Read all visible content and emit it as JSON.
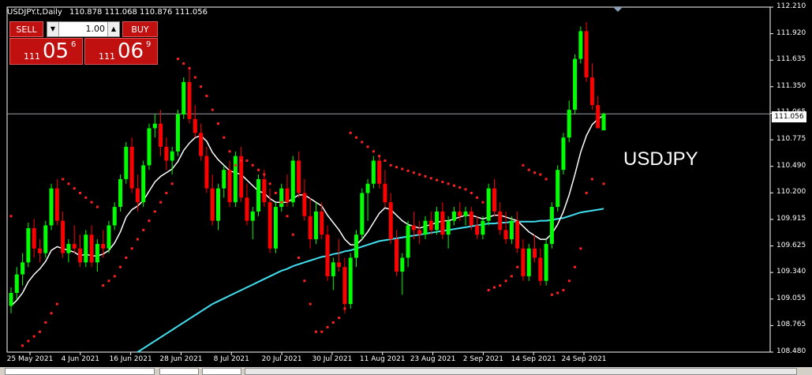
{
  "header": {
    "symbol": "USDJPY.t,Daily",
    "ohlc": "110.878 111.068 110.876 111.056"
  },
  "trade_panel": {
    "sell_label": "SELL",
    "buy_label": "BUY",
    "lot_value": "1.00",
    "sell_small": "111",
    "sell_big": "05",
    "sell_sup": "6",
    "buy_small": "111",
    "buy_big": "06",
    "buy_sup": "9"
  },
  "watermark": "USDJPY",
  "current_price_label": "111.056",
  "colors": {
    "bull": "#00ff00",
    "bear": "#ff0000",
    "ma_fast": "#ffffff",
    "ma_slow": "#40e0f0",
    "sar": "#ff2020",
    "background": "#000000"
  },
  "chart_data": {
    "type": "candlestick",
    "ylim": [
      108.48,
      112.21
    ],
    "y_ticks": [
      "112.210",
      "111.920",
      "111.635",
      "111.350",
      "111.065",
      "110.775",
      "110.490",
      "110.200",
      "109.915",
      "109.625",
      "109.340",
      "109.055",
      "108.765",
      "108.480"
    ],
    "x_ticks": [
      "25 May 2021",
      "4 Jun 2021",
      "16 Jun 2021",
      "28 Jun 2021",
      "8 Jul 2021",
      "20 Jul 2021",
      "30 Jul 2021",
      "11 Aug 2021",
      "23 Aug 2021",
      "2 Sep 2021",
      "14 Sep 2021",
      "24 Sep 2021"
    ],
    "current_price": 111.056,
    "candles": [
      [
        108.98,
        109.18,
        108.9,
        109.12
      ],
      [
        109.12,
        109.4,
        109.05,
        109.32
      ],
      [
        109.32,
        109.55,
        109.2,
        109.45
      ],
      [
        109.45,
        109.88,
        109.4,
        109.82
      ],
      [
        109.82,
        109.92,
        109.5,
        109.6
      ],
      [
        109.6,
        109.7,
        109.45,
        109.55
      ],
      [
        109.55,
        109.9,
        109.5,
        109.85
      ],
      [
        109.85,
        110.3,
        109.8,
        110.25
      ],
      [
        110.25,
        110.35,
        109.85,
        109.9
      ],
      [
        109.9,
        110.0,
        109.5,
        109.55
      ],
      [
        109.55,
        109.7,
        109.45,
        109.65
      ],
      [
        109.65,
        109.85,
        109.55,
        109.6
      ],
      [
        109.6,
        109.75,
        109.4,
        109.45
      ],
      [
        109.45,
        109.8,
        109.4,
        109.75
      ],
      [
        109.75,
        109.85,
        109.4,
        109.45
      ],
      [
        109.45,
        109.7,
        109.35,
        109.65
      ],
      [
        109.65,
        109.8,
        109.5,
        109.6
      ],
      [
        109.6,
        109.9,
        109.55,
        109.85
      ],
      [
        109.85,
        110.1,
        109.8,
        110.05
      ],
      [
        110.05,
        110.4,
        110.0,
        110.35
      ],
      [
        110.35,
        110.75,
        110.3,
        110.7
      ],
      [
        110.7,
        110.8,
        110.2,
        110.25
      ],
      [
        110.25,
        110.4,
        110.0,
        110.1
      ],
      [
        110.1,
        110.55,
        110.05,
        110.5
      ],
      [
        110.5,
        110.95,
        110.45,
        110.9
      ],
      [
        110.9,
        111.05,
        110.8,
        110.95
      ],
      [
        110.95,
        111.1,
        110.6,
        110.7
      ],
      [
        110.7,
        110.8,
        110.45,
        110.55
      ],
      [
        110.55,
        110.7,
        110.4,
        110.65
      ],
      [
        110.65,
        111.1,
        110.6,
        111.05
      ],
      [
        111.05,
        111.45,
        111.0,
        111.4
      ],
      [
        111.4,
        111.55,
        110.95,
        111.0
      ],
      [
        111.0,
        111.15,
        110.8,
        110.85
      ],
      [
        110.85,
        110.95,
        110.55,
        110.6
      ],
      [
        110.6,
        110.7,
        110.2,
        110.25
      ],
      [
        110.25,
        110.4,
        109.85,
        109.9
      ],
      [
        109.9,
        110.3,
        109.8,
        110.25
      ],
      [
        110.25,
        110.5,
        110.15,
        110.45
      ],
      [
        110.45,
        110.55,
        110.05,
        110.1
      ],
      [
        110.1,
        110.65,
        110.05,
        110.6
      ],
      [
        110.6,
        110.7,
        110.1,
        110.15
      ],
      [
        110.15,
        110.3,
        109.85,
        109.9
      ],
      [
        109.9,
        110.05,
        109.7,
        110.0
      ],
      [
        110.0,
        110.4,
        109.95,
        110.35
      ],
      [
        110.35,
        110.45,
        110.05,
        110.1
      ],
      [
        110.1,
        110.25,
        109.55,
        109.6
      ],
      [
        109.6,
        110.1,
        109.55,
        110.05
      ],
      [
        110.05,
        110.3,
        110.0,
        110.25
      ],
      [
        110.25,
        110.4,
        110.05,
        110.1
      ],
      [
        110.1,
        110.6,
        110.05,
        110.55
      ],
      [
        110.55,
        110.65,
        110.15,
        110.2
      ],
      [
        110.2,
        110.35,
        109.9,
        109.95
      ],
      [
        109.95,
        110.15,
        109.6,
        109.7
      ],
      [
        109.7,
        110.1,
        109.65,
        110.0
      ],
      [
        110.0,
        110.1,
        109.7,
        109.75
      ],
      [
        109.75,
        109.85,
        109.25,
        109.3
      ],
      [
        109.3,
        109.5,
        109.15,
        109.45
      ],
      [
        109.45,
        109.7,
        109.35,
        109.4
      ],
      [
        109.4,
        109.5,
        108.9,
        109.0
      ],
      [
        109.0,
        109.55,
        108.95,
        109.5
      ],
      [
        109.5,
        109.8,
        109.4,
        109.75
      ],
      [
        109.75,
        110.25,
        109.7,
        110.2
      ],
      [
        110.2,
        110.35,
        109.9,
        110.3
      ],
      [
        110.3,
        110.6,
        110.25,
        110.55
      ],
      [
        110.55,
        110.6,
        110.25,
        110.3
      ],
      [
        110.3,
        110.45,
        110.05,
        110.1
      ],
      [
        110.1,
        110.2,
        109.65,
        109.7
      ],
      [
        109.7,
        109.8,
        109.3,
        109.35
      ],
      [
        109.35,
        109.55,
        109.1,
        109.5
      ],
      [
        109.5,
        109.9,
        109.4,
        109.85
      ],
      [
        109.85,
        110.0,
        109.7,
        109.8
      ],
      [
        109.8,
        109.9,
        109.65,
        109.75
      ],
      [
        109.75,
        109.95,
        109.7,
        109.9
      ],
      [
        109.9,
        110.0,
        109.75,
        109.8
      ],
      [
        109.8,
        110.05,
        109.75,
        110.0
      ],
      [
        110.0,
        110.1,
        109.7,
        109.75
      ],
      [
        109.75,
        109.95,
        109.6,
        109.9
      ],
      [
        109.9,
        110.05,
        109.85,
        110.0
      ],
      [
        110.0,
        110.1,
        109.9,
        109.95
      ],
      [
        109.95,
        110.05,
        109.85,
        110.0
      ],
      [
        110.0,
        110.05,
        109.8,
        109.85
      ],
      [
        109.85,
        109.95,
        109.7,
        109.75
      ],
      [
        109.75,
        109.95,
        109.7,
        109.9
      ],
      [
        109.9,
        110.3,
        109.85,
        110.25
      ],
      [
        110.25,
        110.35,
        109.95,
        110.0
      ],
      [
        110.0,
        110.1,
        109.75,
        109.8
      ],
      [
        109.8,
        110.0,
        109.65,
        109.7
      ],
      [
        109.7,
        109.95,
        109.65,
        109.9
      ],
      [
        109.9,
        110.0,
        109.55,
        109.6
      ],
      [
        109.6,
        109.7,
        109.25,
        109.3
      ],
      [
        109.3,
        109.65,
        109.25,
        109.6
      ],
      [
        109.6,
        109.75,
        109.45,
        109.5
      ],
      [
        109.5,
        109.6,
        109.2,
        109.25
      ],
      [
        109.25,
        109.7,
        109.2,
        109.65
      ],
      [
        109.65,
        110.1,
        109.6,
        110.05
      ],
      [
        110.05,
        110.5,
        110.0,
        110.45
      ],
      [
        110.45,
        110.85,
        110.4,
        110.8
      ],
      [
        110.8,
        111.2,
        110.75,
        111.1
      ],
      [
        111.1,
        111.7,
        111.05,
        111.65
      ],
      [
        111.65,
        112.0,
        111.6,
        111.95
      ],
      [
        111.95,
        112.05,
        111.4,
        111.45
      ],
      [
        111.45,
        111.6,
        111.1,
        111.15
      ],
      [
        111.15,
        111.25,
        110.9,
        110.9
      ],
      [
        110.878,
        111.068,
        110.876,
        111.056
      ]
    ],
    "ma_fast": [
      108.98,
      109.04,
      109.12,
      109.24,
      109.32,
      109.38,
      109.46,
      109.58,
      109.62,
      109.6,
      109.58,
      109.56,
      109.52,
      109.54,
      109.52,
      109.52,
      109.54,
      109.58,
      109.66,
      109.78,
      109.94,
      110.02,
      110.06,
      110.12,
      110.22,
      110.32,
      110.38,
      110.42,
      110.46,
      110.54,
      110.66,
      110.74,
      110.8,
      110.82,
      110.76,
      110.64,
      110.56,
      110.5,
      110.44,
      110.42,
      110.4,
      110.34,
      110.28,
      110.22,
      110.2,
      110.14,
      110.1,
      110.1,
      110.1,
      110.14,
      110.18,
      110.18,
      110.14,
      110.1,
      110.06,
      109.96,
      109.88,
      109.8,
      109.7,
      109.64,
      109.64,
      109.7,
      109.78,
      109.88,
      109.98,
      110.04,
      110.02,
      109.96,
      109.9,
      109.86,
      109.84,
      109.82,
      109.84,
      109.86,
      109.88,
      109.9,
      109.9,
      109.92,
      109.94,
      109.96,
      109.96,
      109.94,
      109.92,
      109.94,
      109.96,
      109.96,
      109.94,
      109.92,
      109.9,
      109.84,
      109.78,
      109.74,
      109.7,
      109.7,
      109.76,
      109.86,
      110.0,
      110.18,
      110.4,
      110.64,
      110.82,
      110.94,
      111.0,
      111.04
    ],
    "ma_slow": [
      null,
      null,
      null,
      null,
      null,
      null,
      null,
      null,
      null,
      null,
      null,
      null,
      null,
      null,
      null,
      null,
      null,
      null,
      null,
      null,
      null,
      null,
      108.48,
      108.52,
      108.56,
      108.6,
      108.64,
      108.68,
      108.72,
      108.76,
      108.8,
      108.84,
      108.88,
      108.92,
      108.96,
      109.0,
      109.03,
      109.06,
      109.09,
      109.12,
      109.15,
      109.18,
      109.21,
      109.24,
      109.27,
      109.3,
      109.33,
      109.36,
      109.38,
      109.41,
      109.43,
      109.45,
      109.47,
      109.49,
      109.51,
      109.52,
      109.54,
      109.55,
      109.57,
      109.58,
      109.6,
      109.62,
      109.64,
      109.66,
      109.68,
      109.69,
      109.7,
      109.71,
      109.72,
      109.73,
      109.74,
      109.75,
      109.76,
      109.77,
      109.78,
      109.79,
      109.8,
      109.81,
      109.82,
      109.83,
      109.84,
      109.85,
      109.86,
      109.87,
      109.87,
      109.88,
      109.88,
      109.89,
      109.89,
      109.89,
      109.89,
      109.89,
      109.9,
      109.9,
      109.91,
      109.92,
      109.93,
      109.95,
      109.97,
      109.99,
      110.0,
      110.01,
      110.02,
      110.03
    ],
    "sar": [
      109.95,
      null,
      108.55,
      108.6,
      108.65,
      108.7,
      108.8,
      108.9,
      109.0,
      110.35,
      110.3,
      110.25,
      110.2,
      110.15,
      110.1,
      110.05,
      109.2,
      109.25,
      109.3,
      109.4,
      109.5,
      109.6,
      109.7,
      109.8,
      109.9,
      110.0,
      110.1,
      110.2,
      110.3,
      111.65,
      111.6,
      111.55,
      111.45,
      111.35,
      111.25,
      111.1,
      110.95,
      110.8,
      110.65,
      110.5,
      110.55,
      110.55,
      110.5,
      110.45,
      110.4,
      110.3,
      110.2,
      110.1,
      109.95,
      109.75,
      109.5,
      109.25,
      109.0,
      108.7,
      108.7,
      108.75,
      108.8,
      108.85,
      108.95,
      110.85,
      110.8,
      110.75,
      110.7,
      110.65,
      110.6,
      110.55,
      110.5,
      110.48,
      110.46,
      110.44,
      110.42,
      110.4,
      110.38,
      110.36,
      110.34,
      110.32,
      110.3,
      110.28,
      110.26,
      110.24,
      110.2,
      110.15,
      110.1,
      109.15,
      109.18,
      109.2,
      109.25,
      109.3,
      109.4,
      110.5,
      110.45,
      110.42,
      110.4,
      110.35,
      109.1,
      109.12,
      109.15,
      109.25,
      109.4,
      109.6,
      110.2,
      110.35,
      null,
      110.3
    ]
  }
}
